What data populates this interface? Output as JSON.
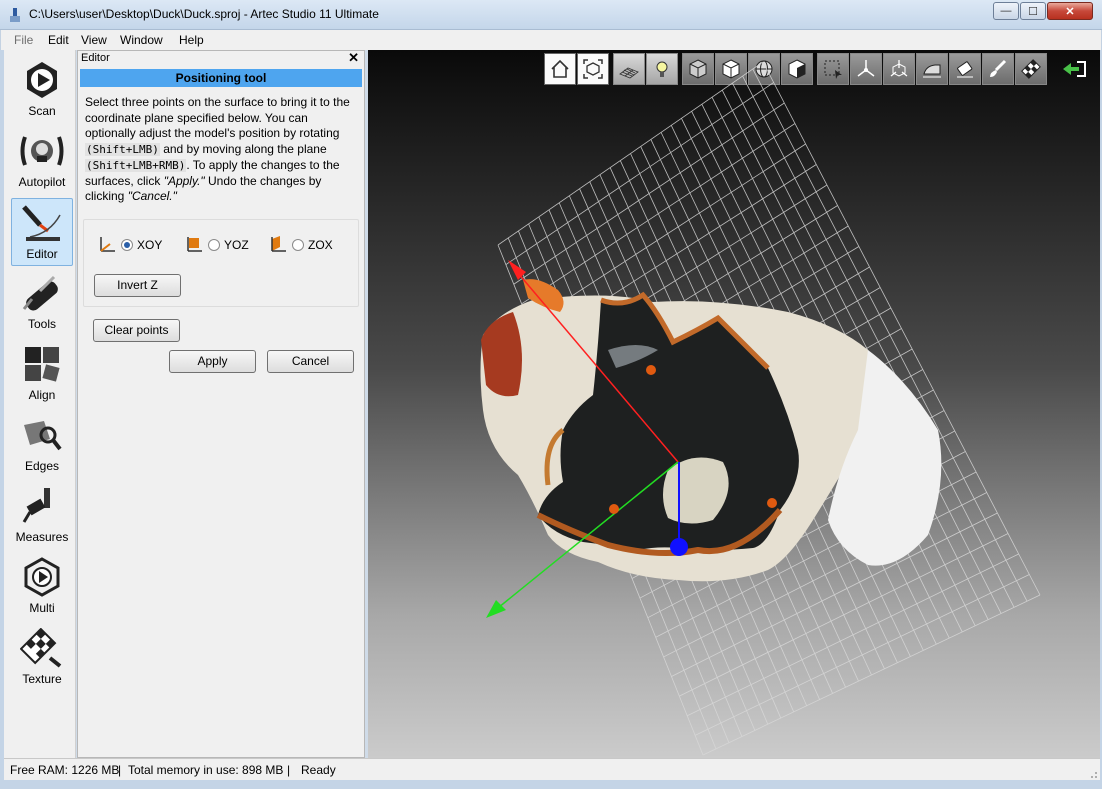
{
  "window": {
    "title": "C:\\Users\\user\\Desktop\\Duck\\Duck.sproj - Artec Studio 11 Ultimate",
    "min_glyph": "—",
    "max_glyph": "☐",
    "close_glyph": "✕"
  },
  "menu": [
    "File",
    "Edit",
    "View",
    "Window",
    "Help"
  ],
  "tools": [
    {
      "label": "Scan",
      "icon": "scan-icon"
    },
    {
      "label": "Autopilot",
      "icon": "autopilot-icon"
    },
    {
      "label": "Editor",
      "icon": "editor-icon",
      "active": true
    },
    {
      "label": "Tools",
      "icon": "tools-icon"
    },
    {
      "label": "Align",
      "icon": "align-icon"
    },
    {
      "label": "Edges",
      "icon": "edges-icon"
    },
    {
      "label": "Measures",
      "icon": "measures-icon"
    },
    {
      "label": "Multi",
      "icon": "multi-icon"
    },
    {
      "label": "Texture",
      "icon": "texture-icon"
    }
  ],
  "editor": {
    "panel_title": "Editor",
    "close_glyph": "✕",
    "tool_title": "Positioning tool",
    "desc_1": "Select three points on the surface to bring it to the coordinate plane specified below. You can optionally adjust the model's position by rotating ",
    "code_1": "(Shift+LMB)",
    "desc_2": " and by moving along the plane ",
    "code_2": "(Shift+LMB+RMB)",
    "desc_3": ". To apply the changes to the surfaces, click ",
    "apply_em": "\"Apply.\"",
    "desc_4": " Undo the changes by clicking ",
    "cancel_em": "\"Cancel.\"",
    "planes": [
      {
        "label": "XOY",
        "selected": true
      },
      {
        "label": "YOZ",
        "selected": false
      },
      {
        "label": "ZOX",
        "selected": false
      }
    ],
    "invert_z": "Invert Z",
    "clear_points": "Clear points",
    "apply": "Apply",
    "cancel": "Cancel"
  },
  "viewport_toolbar": [
    "home-view-icon",
    "fit-view-icon",
    "grid-icon",
    "light-icon",
    "wireframe-icon",
    "solid-icon",
    "sphere-icon",
    "textured-icon",
    "selection-icon",
    "axis-icon",
    "pivot-icon",
    "iron-icon",
    "eraser-icon",
    "brush-icon",
    "checker-icon",
    "back-arrow-icon"
  ],
  "status": {
    "free_ram": "Free RAM: 1226 MB",
    "sep1": "|",
    "total_mem": "Total memory in use: 898 MB",
    "sep2": "|",
    "state": "Ready"
  },
  "colors": {
    "accent_bar": "#4ea5ef",
    "axis_x": "#ff2020",
    "axis_y": "#22dd22",
    "axis_z": "#1010ff",
    "point_marker": "#e05a10"
  }
}
